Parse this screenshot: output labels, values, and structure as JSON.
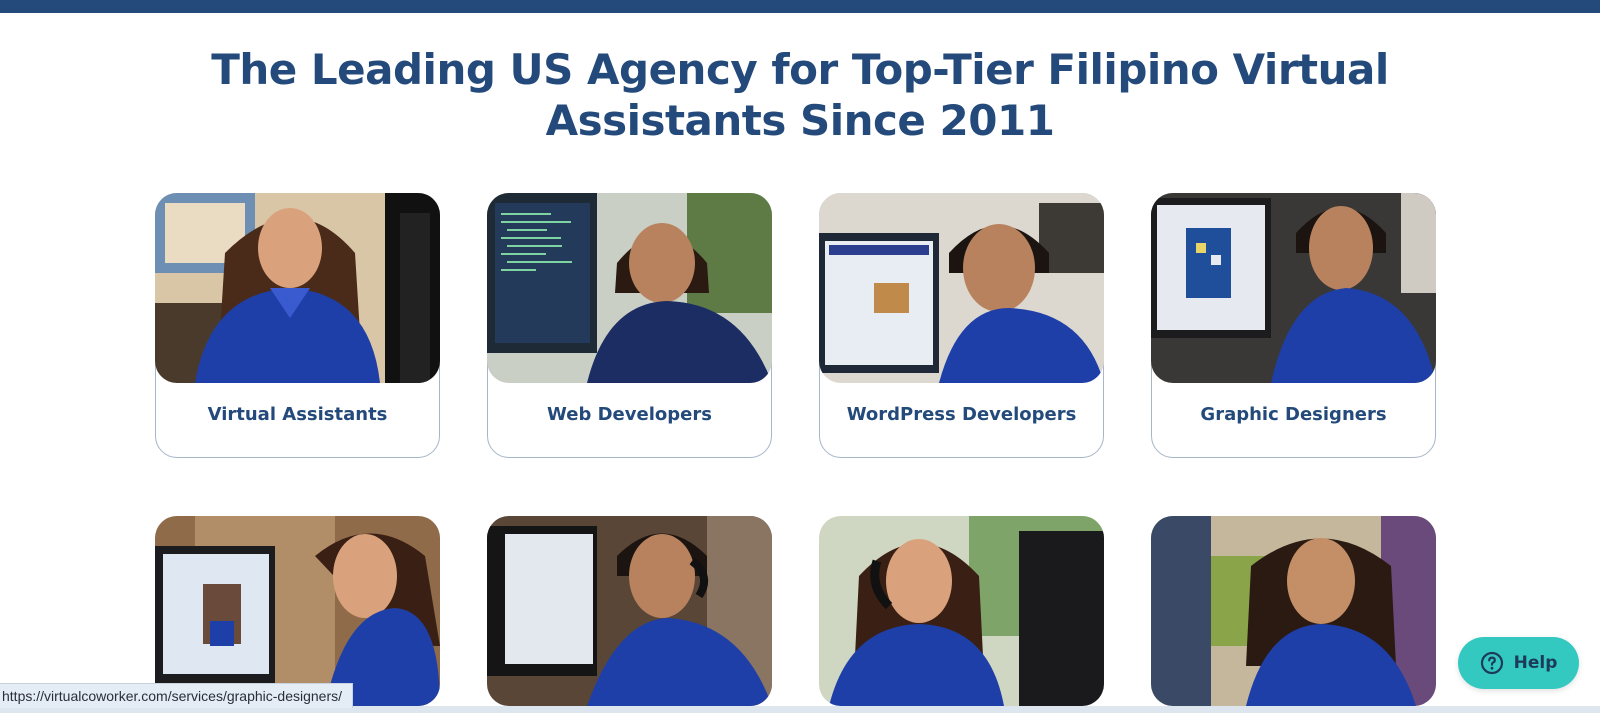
{
  "header": {
    "headline_line1": "The Leading US Agency for Top-Tier Filipino Virtual",
    "headline_line2": "Assistants Since 2011"
  },
  "services": [
    {
      "label": "Virtual Assistants"
    },
    {
      "label": "Web Developers"
    },
    {
      "label": "WordPress Developers"
    },
    {
      "label": "Graphic Designers"
    }
  ],
  "second_row": [
    {
      "photo": "assistant-at-monitor-photo"
    },
    {
      "photo": "headset-agent-photo"
    },
    {
      "photo": "headset-assistant-photo"
    },
    {
      "photo": "office-assistant-photo"
    }
  ],
  "status_bar": {
    "url": "https://virtualcoworker.com/services/graphic-designers/"
  },
  "help_widget": {
    "label": "Help",
    "icon": "question-circle-icon"
  },
  "colors": {
    "brand_navy": "#234a7a",
    "help_teal": "#34c9c0",
    "shirt_blue": "#1f3fa8"
  }
}
